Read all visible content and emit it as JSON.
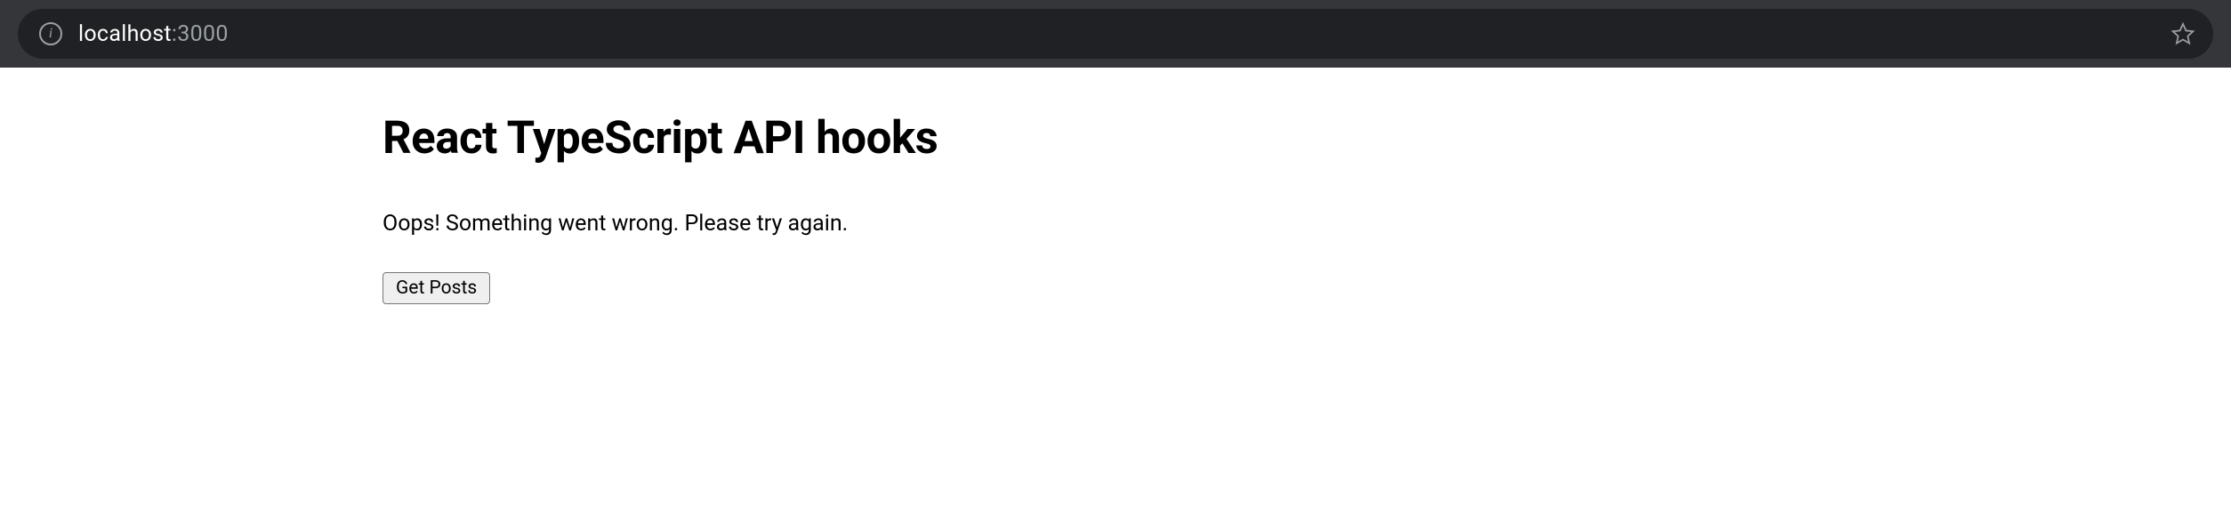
{
  "address_bar": {
    "host": "localhost",
    "port": ":3000"
  },
  "page": {
    "title": "React TypeScript API hooks",
    "error_message": "Oops! Something went wrong. Please try again.",
    "button_label": "Get Posts"
  }
}
